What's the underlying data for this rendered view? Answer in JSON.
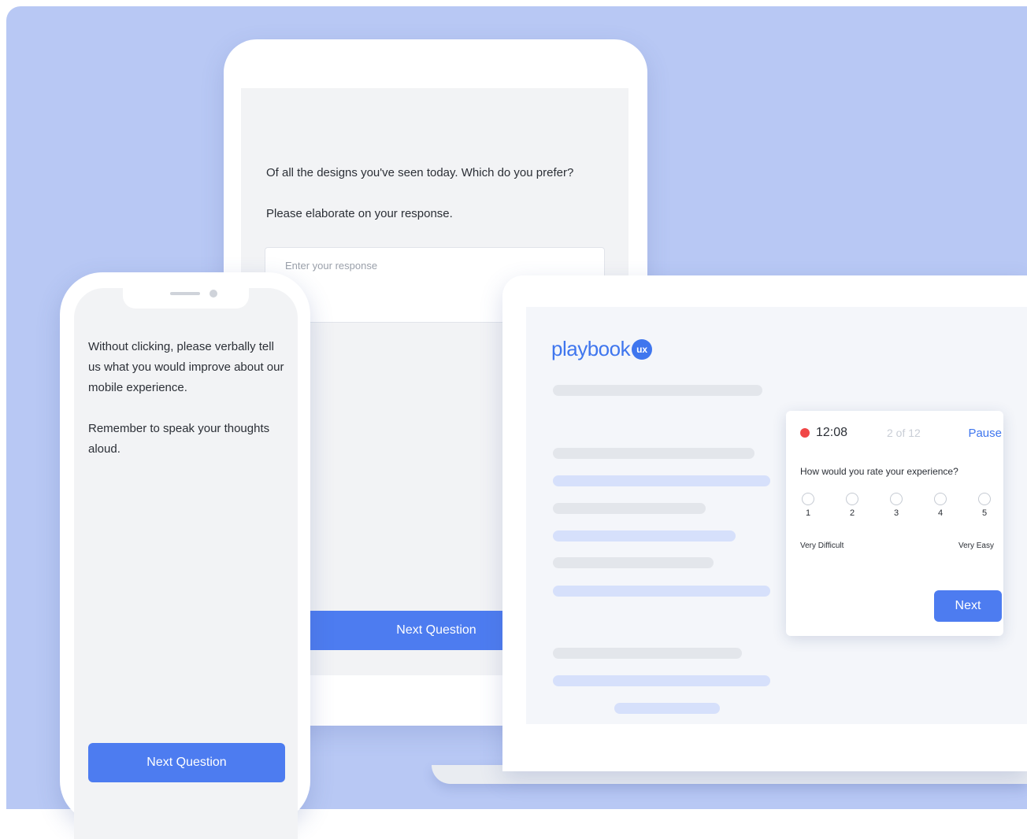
{
  "tablet": {
    "question": "Of all the designs you've seen today. Which do you prefer?",
    "instruction": "Please elaborate on your response.",
    "response_placeholder": "Enter your response",
    "next_button": "Next Question"
  },
  "phone": {
    "prompt": "Without clicking, please verbally tell us what you would improve about our mobile experience.",
    "reminder": "Remember to speak your thoughts aloud.",
    "next_button": "Next Question"
  },
  "laptop": {
    "logo_text": "playbook",
    "logo_badge": "ux",
    "card": {
      "timer": "12:08",
      "progress": "2 of 12",
      "pause_label": "Pause",
      "question": "How would you rate your experience?",
      "scale": [
        "1",
        "2",
        "3",
        "4",
        "5"
      ],
      "min_label": "Very Difficult",
      "max_label": "Very Easy",
      "next_button": "Next"
    }
  },
  "colors": {
    "background": "#b8c8f4",
    "accent": "#4d7cf0",
    "brand": "#3f76ee",
    "recording": "#f04646"
  }
}
